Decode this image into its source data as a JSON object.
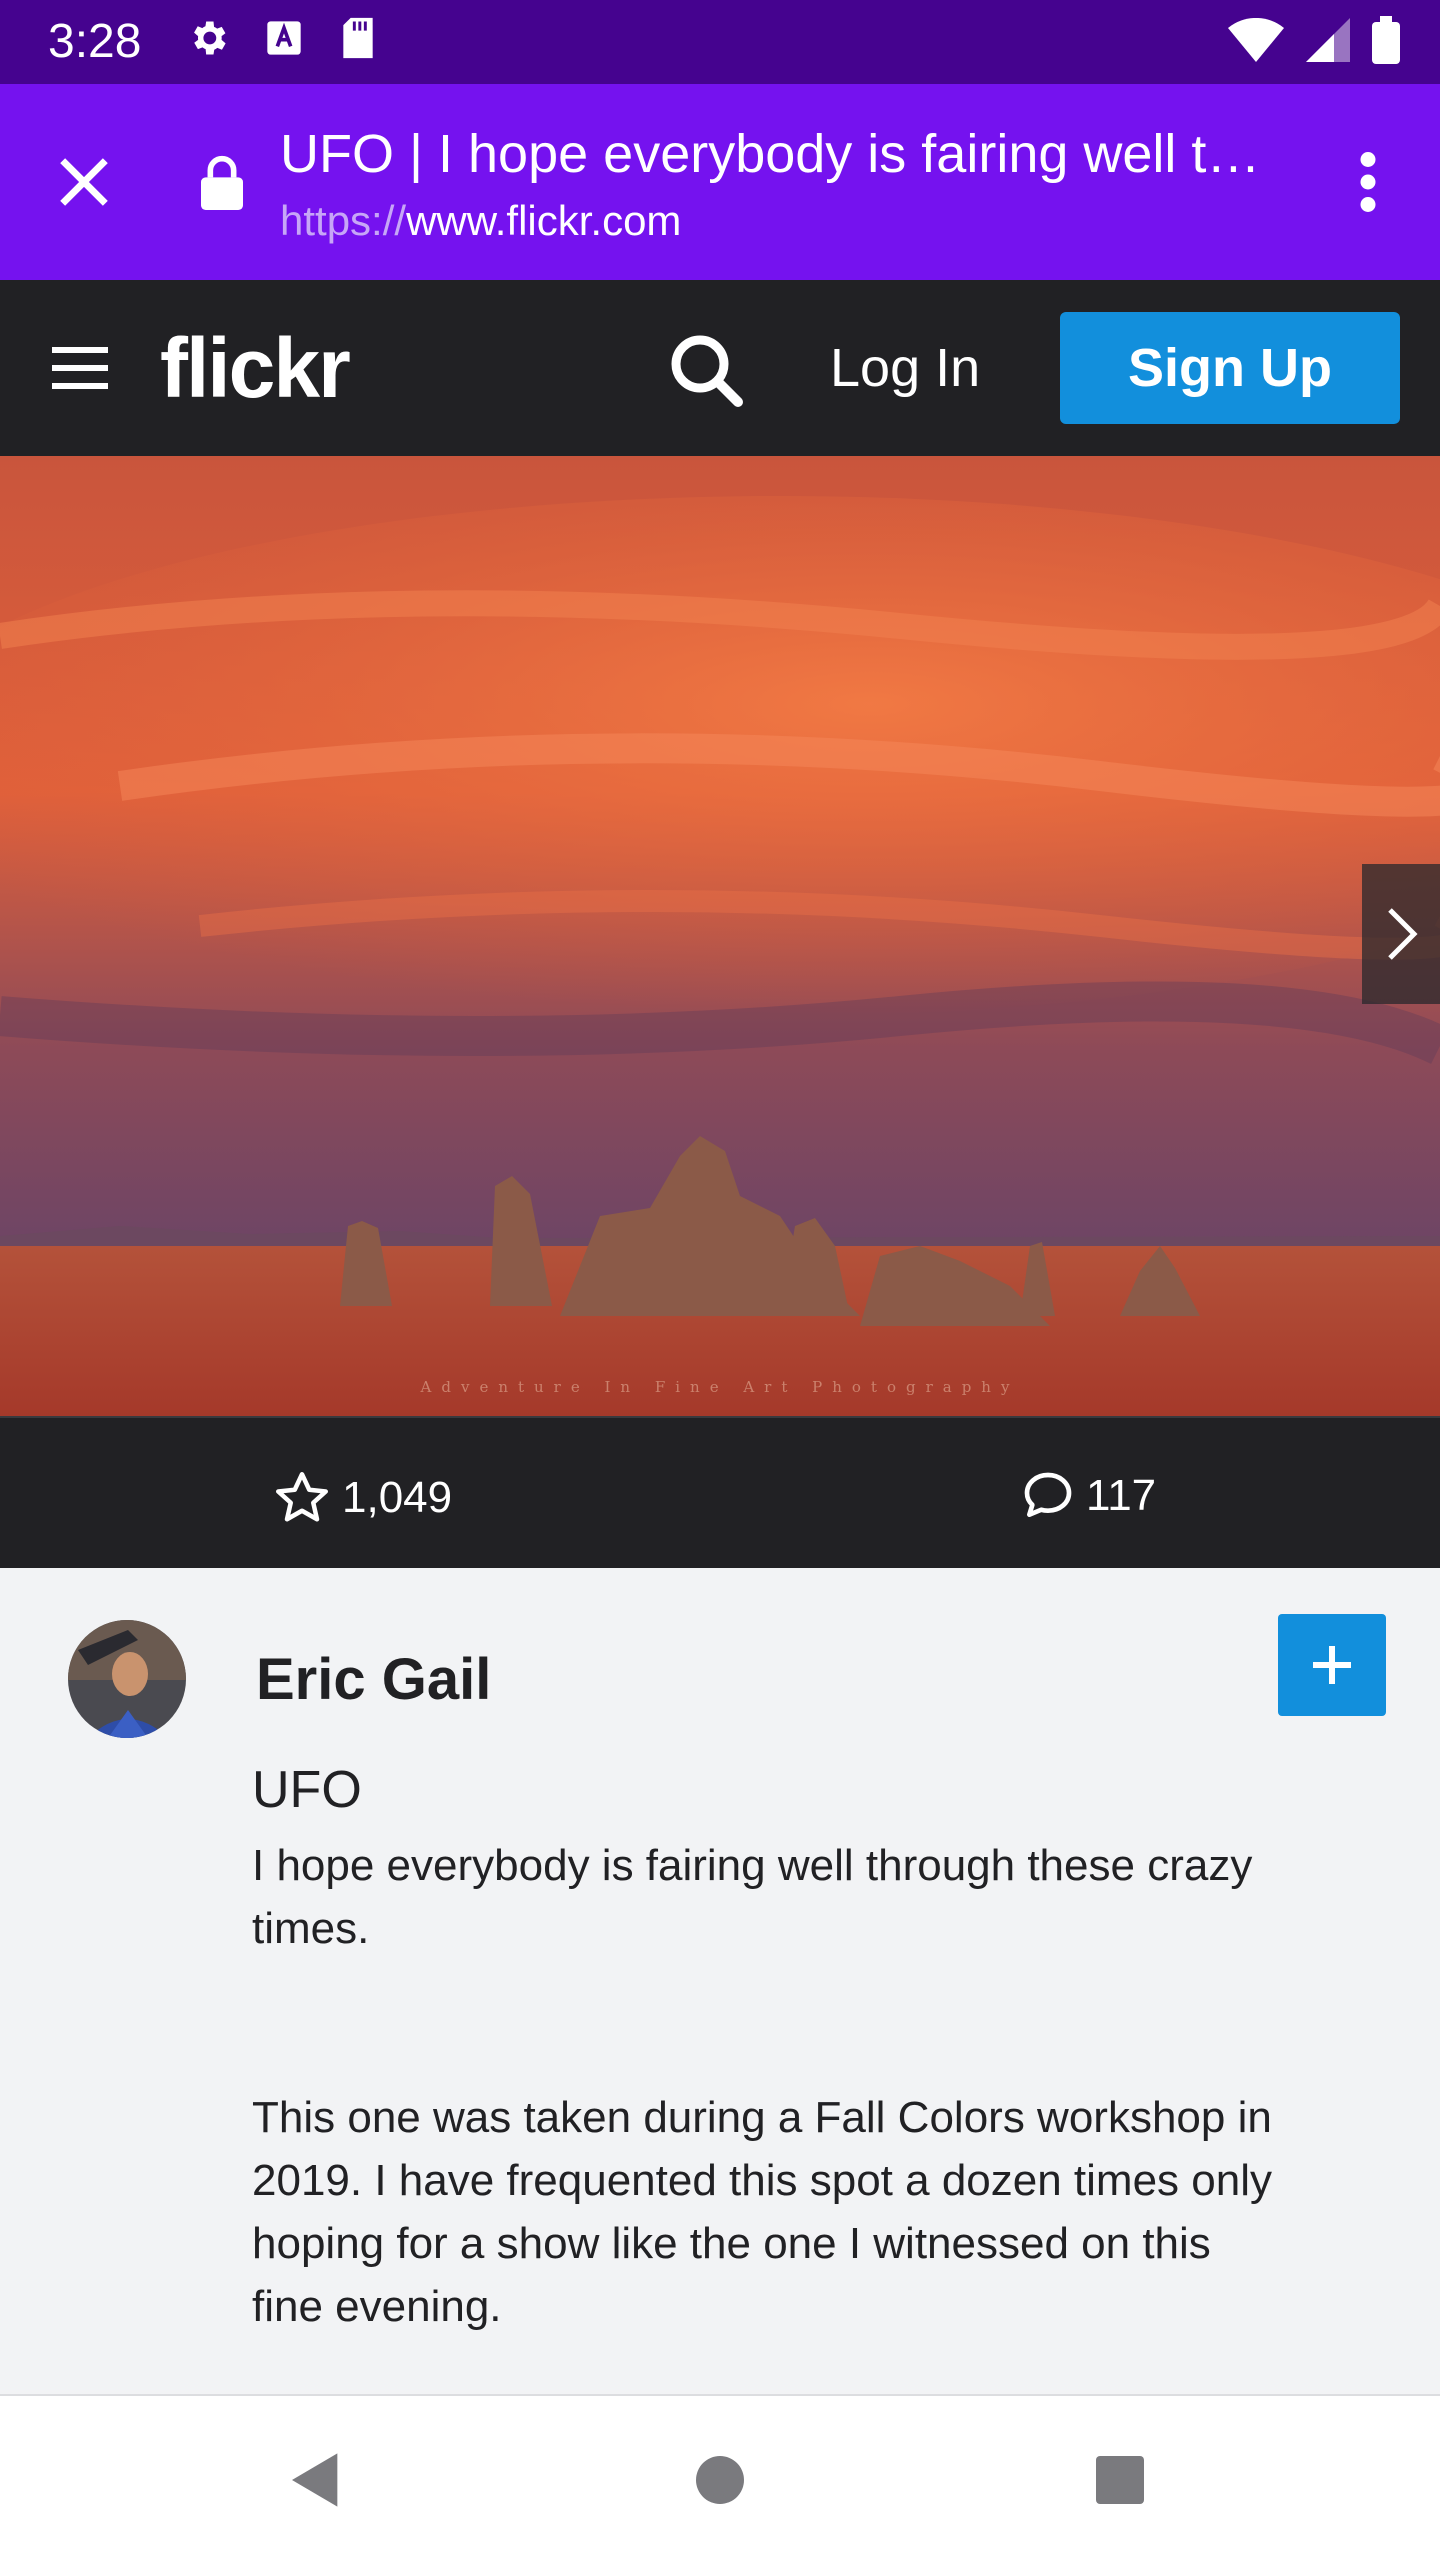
{
  "status_bar": {
    "time": "3:28",
    "left_icons": [
      "gear-icon",
      "a-icon",
      "sd-card-icon"
    ],
    "right_icons": [
      "wifi-icon",
      "signal-icon",
      "battery-icon"
    ]
  },
  "custom_tab": {
    "title": "UFO | I hope everybody is fairing well t…",
    "url_scheme": "https://",
    "url_host": "www.flickr.com",
    "colors": {
      "status": "#45038f",
      "bar": "#7512ef"
    }
  },
  "header": {
    "logo": "flickr",
    "login_label": "Log In",
    "signup_label": "Sign Up",
    "accent": "#128fdc"
  },
  "photo": {
    "watermark": "Adventure In Fine Art Photography"
  },
  "stats": {
    "faves": "1,049",
    "comments": "117"
  },
  "owner": {
    "name": "Eric Gail"
  },
  "photo_info": {
    "title": "UFO",
    "description": [
      "I hope everybody is fairing well through these crazy times.",
      "This one was taken during a Fall Colors workshop in 2019. I have frequented this spot a dozen times only hoping for a show like the one I witnessed on this fine evening."
    ]
  }
}
